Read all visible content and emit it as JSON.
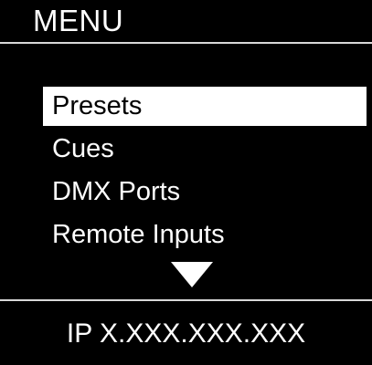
{
  "header": {
    "title": "MENU"
  },
  "menu": {
    "items": [
      {
        "label": "Presets",
        "selected": true
      },
      {
        "label": "Cues",
        "selected": false
      },
      {
        "label": "DMX Ports",
        "selected": false
      },
      {
        "label": "Remote Inputs",
        "selected": false
      }
    ],
    "scroll_icon": "down-arrow-icon"
  },
  "footer": {
    "ip_text": "IP X.XXX.XXX.XXX"
  },
  "colors": {
    "background": "#000000",
    "foreground": "#ffffff",
    "selection_background": "#ffffff",
    "selection_text": "#000000"
  }
}
